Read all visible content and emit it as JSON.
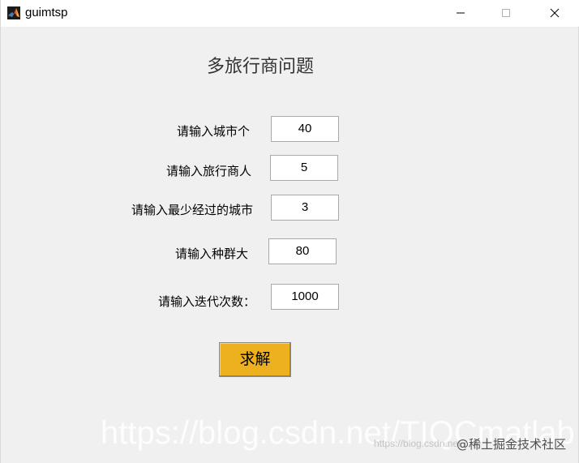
{
  "window": {
    "title": "guimtsp"
  },
  "heading": "多旅行商问题",
  "fields": [
    {
      "label": "请输入城市个",
      "value": "40"
    },
    {
      "label": "请输入旅行商人",
      "value": "5"
    },
    {
      "label": "请输入最少经过的城市",
      "value": "3"
    },
    {
      "label": "请输入种群大",
      "value": "80"
    },
    {
      "label": "请输入迭代次数：",
      "value": "1000"
    }
  ],
  "solve_button_label": "求解",
  "watermark": {
    "text": "https://blog.csdn.net/TIQCmatlab",
    "small_text": "https://blog.csdn.net",
    "badge": "@稀土掘金技术社区"
  },
  "colors": {
    "window_bg": "#f0f0f0",
    "button_bg": "#edb120",
    "titlebar_bg": "#ffffff"
  },
  "icons": {
    "app": "matlab-logo-icon",
    "minimize": "minimize-icon",
    "maximize": "maximize-icon",
    "close": "close-icon"
  }
}
